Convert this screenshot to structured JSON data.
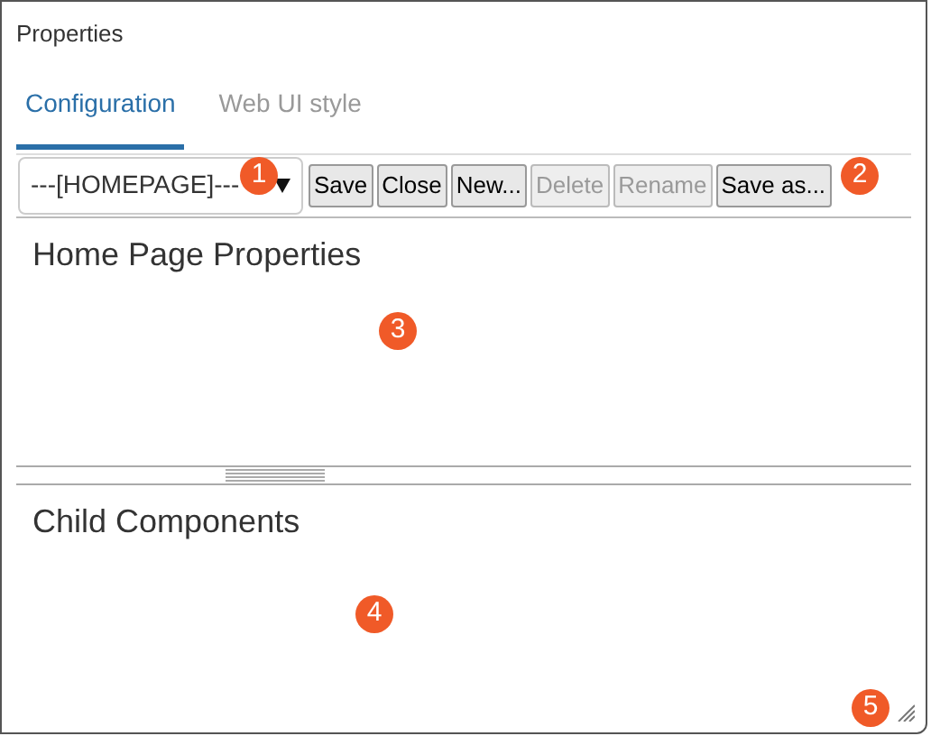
{
  "window": {
    "title": "Properties"
  },
  "tabs": [
    {
      "label": "Configuration",
      "selected": true
    },
    {
      "label": "Web UI style",
      "selected": false
    }
  ],
  "toolbar": {
    "dropdown": {
      "value": "---[HOMEPAGE]---"
    },
    "buttons": [
      {
        "label": "Save",
        "disabled": false
      },
      {
        "label": "Close",
        "disabled": false
      },
      {
        "label": "New...",
        "disabled": false
      },
      {
        "label": "Delete",
        "disabled": true
      },
      {
        "label": "Rename",
        "disabled": true
      },
      {
        "label": "Save as...",
        "disabled": false
      }
    ]
  },
  "panels": [
    {
      "heading": "Home Page Properties"
    },
    {
      "heading": "Child Components"
    }
  ],
  "callouts": [
    "1",
    "2",
    "3",
    "4",
    "5"
  ]
}
